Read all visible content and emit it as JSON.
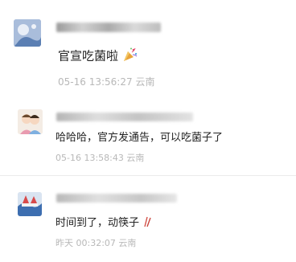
{
  "comments": [
    {
      "text": "官宣吃菌啦",
      "emoji": "party-popper-icon",
      "date": "05-16",
      "time": "13:56:27",
      "location": "云南"
    },
    {
      "text": "哈哈哈，官方发通告，可以吃菌子了",
      "date": "05-16",
      "time": "13:58:43",
      "location": "云南"
    },
    {
      "text": "时间到了，动筷子",
      "emoji": "chopsticks-icon",
      "date": "昨天",
      "time": "00:32:07",
      "location": "云南"
    }
  ],
  "colors": {
    "text": "#222222",
    "meta": "#b8b8b8",
    "divider": "#ebebeb"
  }
}
